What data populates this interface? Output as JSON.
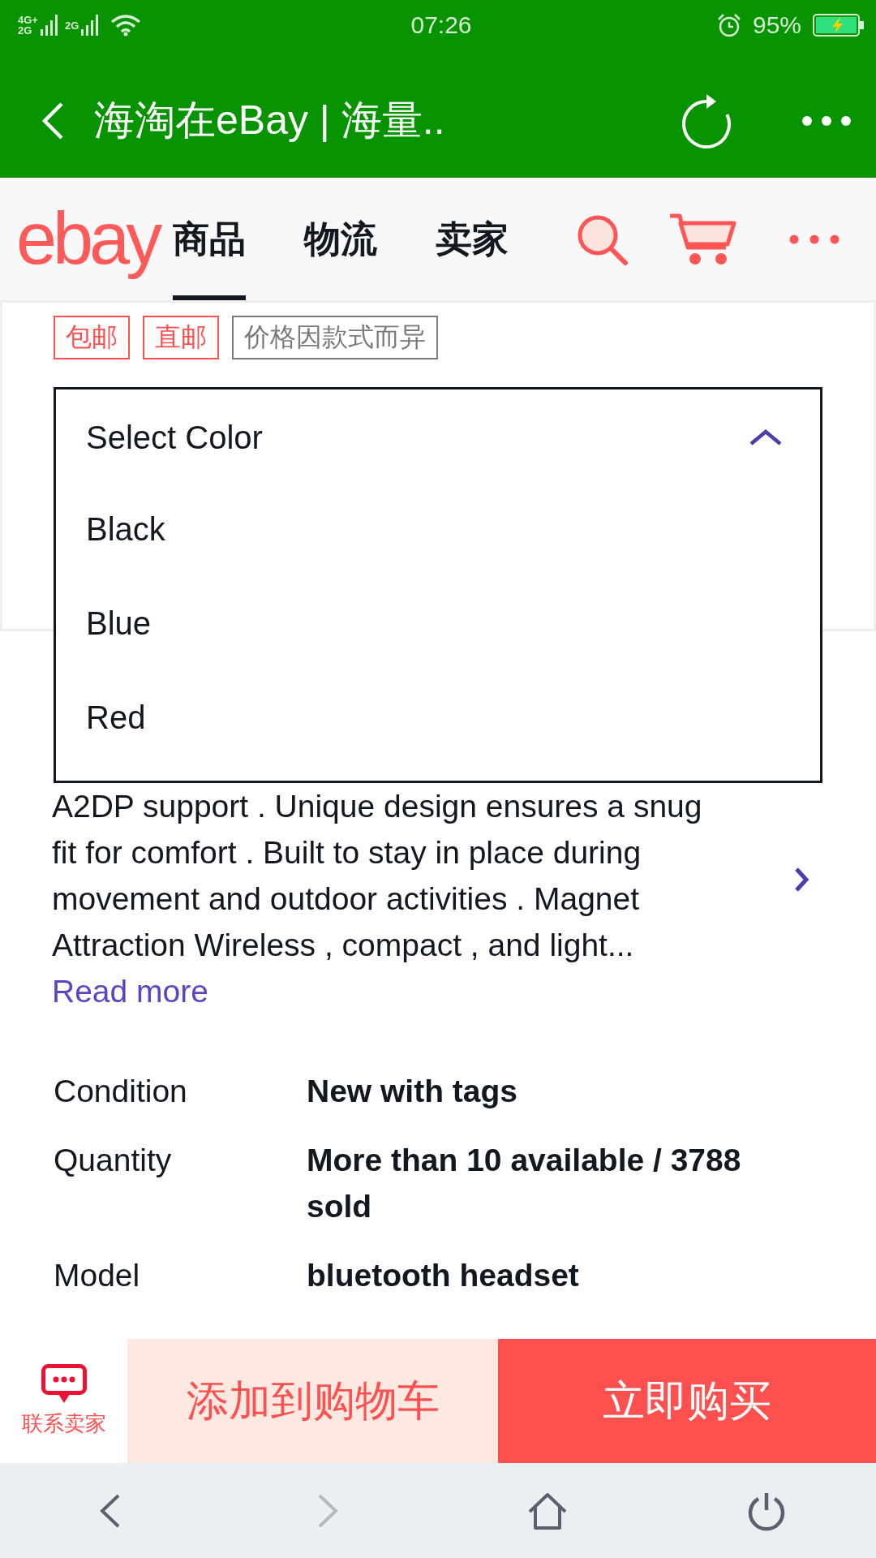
{
  "status_bar": {
    "signals": [
      {
        "labels": [
          "4G+",
          "2G"
        ]
      },
      {
        "labels": [
          "2G"
        ]
      }
    ],
    "time": "07:26",
    "battery": "95%",
    "charging": true
  },
  "title_bar": {
    "title": "海淘在eBay | 海量.."
  },
  "header": {
    "logo": "ebay",
    "tabs": [
      {
        "label": "商品",
        "selected": true
      },
      {
        "label": "物流",
        "selected": false
      },
      {
        "label": "卖家",
        "selected": false
      }
    ]
  },
  "tags": [
    {
      "label": "包邮",
      "kind": "highlight"
    },
    {
      "label": "直邮",
      "kind": "highlight"
    },
    {
      "label": "价格因款式而异",
      "kind": "note"
    }
  ],
  "color_select": {
    "label": "Select Color",
    "expanded": true,
    "options": [
      "Black",
      "Blue",
      "Red"
    ]
  },
  "description": {
    "text": "A2DP support . Unique design ensures a snug fit for comfort . Built to stay in place during movement and outdoor activities . Magnet Attraction Wireless , compact , and light...",
    "link": "Read more"
  },
  "specs": [
    {
      "label": "Condition",
      "value": "New with tags"
    },
    {
      "label": "Quantity",
      "value": "More than 10 available / 3788 sold"
    },
    {
      "label": "Model",
      "value": "bluetooth headset"
    }
  ],
  "action_bar": {
    "contact": "联系卖家",
    "add_to_cart": "添加到购物车",
    "buy_now": "立即购买"
  },
  "browser_nav": [
    {
      "kind": "back",
      "disabled": false
    },
    {
      "kind": "forward",
      "disabled": true
    },
    {
      "kind": "home",
      "disabled": false
    },
    {
      "kind": "power",
      "disabled": false
    }
  ]
}
